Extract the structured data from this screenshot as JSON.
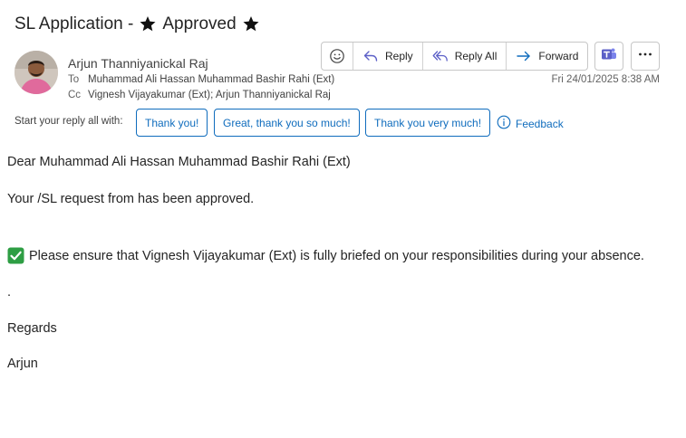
{
  "email": {
    "subject_prefix": "SL Application -",
    "subject_status": "Approved",
    "sender": "Arjun Thanniyanickal Raj",
    "to_label": "To",
    "to": "Muhammad Ali Hassan Muhammad Bashir Rahi (Ext)",
    "cc_label": "Cc",
    "cc": "Vignesh Vijayakumar (Ext); Arjun Thanniyanickal Raj",
    "timestamp": "Fri 24/01/2025 8:38 AM"
  },
  "toolbar": {
    "reply": "Reply",
    "reply_all": "Reply All",
    "forward": "Forward"
  },
  "suggested": {
    "label": "Start your reply all with:",
    "chips": [
      "Thank you!",
      "Great, thank you so much!",
      "Thank you very much!"
    ],
    "feedback": "Feedback"
  },
  "body": {
    "greeting": "Dear Muhammad Ali Hassan Muhammad Bashir Rahi (Ext)",
    "line1": "Your /SL request from has been approved.",
    "line2": "Please ensure that Vignesh Vijayakumar (Ext) is fully briefed on your responsibilities during your absence.",
    "dot": ".",
    "regards": "Regards",
    "signature": "Arjun"
  },
  "colors": {
    "accent": "#0f6cbd",
    "teams": "#5b5fc7",
    "check": "#2e9e44"
  }
}
